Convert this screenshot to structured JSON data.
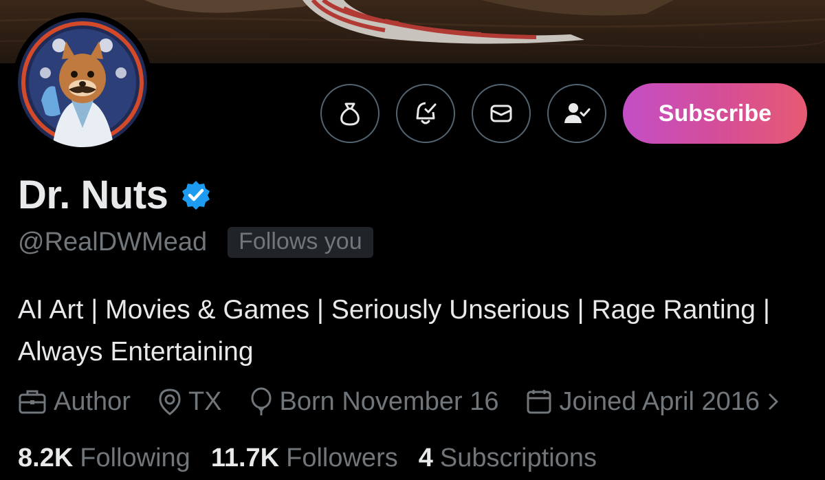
{
  "profile": {
    "display_name": "Dr. Nuts",
    "handle": "@RealDWMead",
    "follows_you": "Follows you",
    "bio": "AI Art | Movies & Games | Seriously Unserious | Rage Ranting | Always Entertaining",
    "verified": true
  },
  "actions": {
    "subscribe_label": "Subscribe",
    "icons": [
      "money-bag-icon",
      "notification-bell-icon",
      "message-envelope-icon",
      "following-person-check-icon"
    ]
  },
  "meta": {
    "profession": "Author",
    "location": "TX",
    "birthday": "Born November 16",
    "joined": "Joined April 2016"
  },
  "stats": {
    "following_count": "8.2K",
    "following_label": "Following",
    "followers_count": "11.7K",
    "followers_label": "Followers",
    "subscriptions_count": "4",
    "subscriptions_label": "Subscriptions"
  },
  "colors": {
    "background": "#000000",
    "primary_text": "#e7e9ea",
    "secondary_text": "#71767b",
    "verified_badge": "#1d9bf0",
    "subscribe_gradient_start": "#c34fc6",
    "subscribe_gradient_end": "#e65a72"
  }
}
